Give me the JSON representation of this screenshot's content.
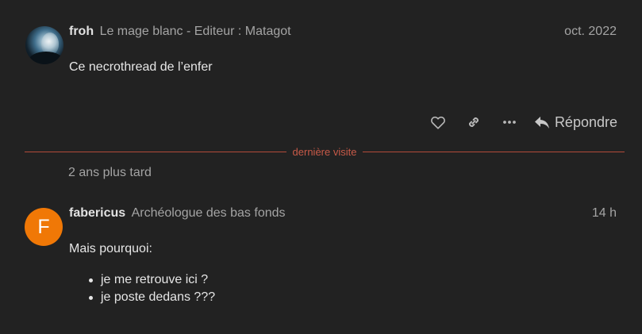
{
  "post1": {
    "avatar_icon": "user-photo-avatar",
    "username": "froh",
    "user_title": "Le mage blanc - Editeur : Matagot",
    "date": "oct. 2022",
    "body": "Ce necrothread de l’enfer",
    "actions": {
      "like_icon": "heart-icon",
      "link_icon": "link-icon",
      "more_icon": "ellipsis-icon",
      "reply_icon": "reply-arrow-icon",
      "reply_label": "Répondre"
    }
  },
  "last_visit_label": "dernière visite",
  "time_gap": "2 ans plus tard",
  "post2": {
    "avatar_letter": "F",
    "avatar_color": "#f07806",
    "username": "fabericus",
    "user_title": "Archéologue des bas fonds",
    "date": "14 h",
    "body_intro": "Mais pourquoi:",
    "body_items": [
      "je me retrouve ici ?",
      "je poste dedans ???"
    ]
  },
  "colors": {
    "background": "#222222",
    "last_visit_line": "#b34a3a"
  }
}
